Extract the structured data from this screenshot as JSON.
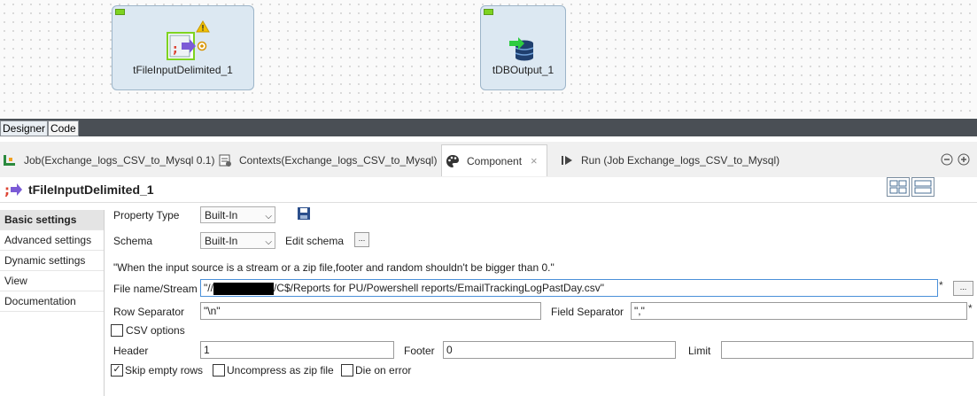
{
  "canvas": {
    "nodes": [
      {
        "label": "tFileInputDelimited_1",
        "warning_icon": "warning-icon"
      },
      {
        "label": "tDBOutput_1"
      }
    ]
  },
  "editor_tabs": [
    "Designer",
    "Code"
  ],
  "view_tabs": [
    {
      "label": "Job(Exchange_logs_CSV_to_Mysql 0.1)"
    },
    {
      "label": "Contexts(Exchange_logs_CSV_to_Mysql)"
    },
    {
      "label": "Component",
      "close": "×"
    },
    {
      "label": "Run (Job Exchange_logs_CSV_to_Mysql)"
    }
  ],
  "component_title": "tFileInputDelimited_1",
  "left_nav": [
    "Basic settings",
    "Advanced settings",
    "Dynamic settings",
    "View",
    "Documentation"
  ],
  "form": {
    "property_type_label": "Property Type",
    "property_type_value": "Built-In",
    "schema_label": "Schema",
    "schema_value": "Built-In",
    "edit_schema_label": "Edit schema",
    "ellipsis": "...",
    "warning_text": "\"When the input source is a stream or a zip file,footer and random shouldn't be bigger than 0.\"",
    "file_label": "File name/Stream",
    "file_prefix": "\"//",
    "file_suffix": "/C$/Reports for PU/Powershell reports/EmailTrackingLogPastDay.csv\"",
    "row_sep_label": "Row Separator",
    "row_sep_value": "\"\\n\"",
    "field_sep_label": "Field Separator",
    "field_sep_value": "\",\"",
    "csv_options_label": "CSV options",
    "header_label": "Header",
    "header_value": "1",
    "footer_label": "Footer",
    "footer_value": "0",
    "limit_label": "Limit",
    "limit_value": "",
    "skip_empty_label": "Skip empty rows",
    "uncompress_label": "Uncompress as zip file",
    "die_on_error_label": "Die on error",
    "required_mark": "*",
    "check_mark": "✓"
  },
  "colors": {
    "accent_green": "#7ed321",
    "dark_bar": "#4a4f55",
    "node_bg": "#dce8f2"
  }
}
